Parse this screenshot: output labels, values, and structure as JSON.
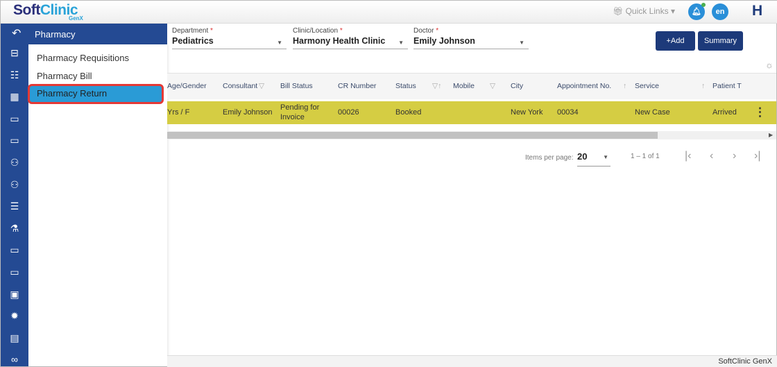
{
  "header": {
    "logo_main": "Soft",
    "logo_accent": "Clinic",
    "logo_sub": "GenX",
    "quick_links": "Quick Links",
    "language": "en",
    "user_initial": "H"
  },
  "menu": {
    "title": "Pharmacy",
    "items": [
      {
        "label": "Pharmacy Requisitions"
      },
      {
        "label": "Pharmacy Bill"
      },
      {
        "label": "Pharmacy Return",
        "active": true
      }
    ]
  },
  "sidebar_icons": [
    "briefcase-icon",
    "id-card-icon",
    "calendar-icon",
    "monitor-icon",
    "monitor-icon",
    "users-icon",
    "users-icon",
    "clipboard-icon",
    "flask-icon",
    "monitor-icon",
    "monitor-icon",
    "safe-icon",
    "badge-icon",
    "book-icon",
    "more-icon"
  ],
  "filters": {
    "department": {
      "label": "Department",
      "value": "Pediatrics"
    },
    "clinic": {
      "label": "Clinic/Location",
      "value": "Harmony Health Clinic"
    },
    "doctor": {
      "label": "Doctor",
      "value": "Emily Johnson"
    }
  },
  "buttons": {
    "add": "+Add",
    "summary": "Summary"
  },
  "table": {
    "columns": [
      "Age/Gender",
      "Consultant",
      "Bill Status",
      "CR Number",
      "Status",
      "Mobile",
      "City",
      "Appointment No.",
      "Service",
      "Patient T"
    ],
    "rows": [
      {
        "age_gender": "Yrs / F",
        "consultant": "Emily Johnson",
        "bill_status_1": "Pending for",
        "bill_status_2": "Invoice",
        "cr_number": "00026",
        "status": "Booked",
        "mobile": "",
        "city": "New York",
        "appointment_no": "00034",
        "service": "New Case",
        "patient": "Arrived"
      }
    ]
  },
  "pagination": {
    "items_per_page_label": "Items per page:",
    "items_per_page": "20",
    "range": "1 – 1 of 1"
  },
  "footer": {
    "text": "SoftClinic GenX"
  },
  "colors": {
    "sidebar": "#244a93",
    "active_item": "#2a9bd6",
    "highlight_row": "#d5cd43",
    "button": "#1d3a7a"
  }
}
